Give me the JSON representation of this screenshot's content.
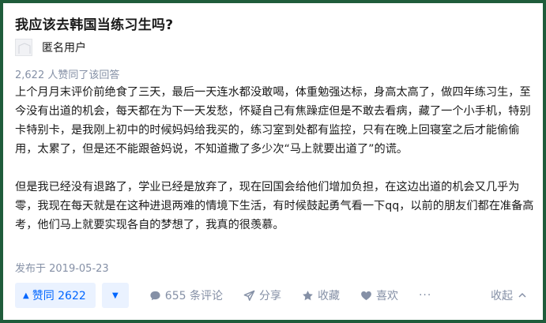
{
  "question": {
    "title": "我应该去韩国当练习生吗?"
  },
  "author": {
    "name": "匿名用户"
  },
  "answer": {
    "votes_text": "2,622 人赞同了该回答",
    "paragraphs": [
      "上个月月末评价前绝食了三天，最后一天连水都没敢喝，体重勉强达标，身高太高了，做四年练习生，至今没有出道的机会，每天都在为下一天发愁，怀疑自己有焦躁症但是不敢去看病，藏了一个小手机，特别卡特别卡，是我刚上初中的时候妈妈给我买的，练习室到处都有监控，只有在晚上回寝室之后才能偷偷用，太累了，但是还不能跟爸妈说，不知道撒了多少次“马上就要出道了”的谎。",
      "但是我已经没有退路了，学业已经是放弃了，现在回国会给他们增加负担，在这边出道的机会又几乎为零，我现在每天就是在这种进退两难的情境下生活，有时候鼓起勇气看一下qq，以前的朋友们都在准备高考，他们马上就要实现各自的梦想了，我真的很羡慕。"
    ],
    "published": "发布于 2019-05-23"
  },
  "actions": {
    "vote_up": "赞同 2622",
    "comments": "655 条评论",
    "share": "分享",
    "favorite": "收藏",
    "like": "喜欢",
    "more": "···",
    "collapse": "收起"
  },
  "colors": {
    "accent": "#0066ff",
    "accent_bg": "#eaf2ff",
    "muted": "#8590a6",
    "frame": "#1f5c3b"
  }
}
